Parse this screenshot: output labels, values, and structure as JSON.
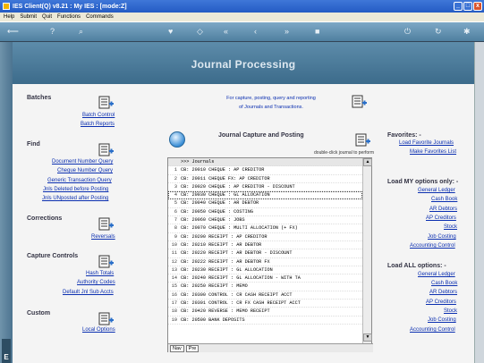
{
  "window": {
    "title": "IES Client(Q) v8.21 : My IES :         [mode:Z]",
    "buttons": {
      "minimize": "_",
      "restore": "□",
      "close": "x"
    }
  },
  "menu": [
    "Help",
    "Submit",
    "Quit",
    "Functions",
    "Commands"
  ],
  "toolbar_icons": [
    "back-icon",
    "help-icon",
    "search-icon",
    "heart-icon",
    "diamond-icon",
    "rewind-icon",
    "back-arrows-icon",
    "forward-arrows-icon",
    "stop-icon",
    "power-icon",
    "refresh-icon",
    "settings-icon"
  ],
  "header": {
    "title": "Journal Processing"
  },
  "batches": {
    "title": "Batches",
    "links": [
      "Batch Control",
      "Batch Reports"
    ]
  },
  "find": {
    "title": "Find",
    "links": [
      "Document Number Query",
      "Cheque Number Query",
      "Generic Transaction Query",
      "Jnls Deleted before Posting",
      "Jnls UNposted after Posting"
    ]
  },
  "corrections": {
    "title": "Corrections",
    "links": [
      "Reversals"
    ]
  },
  "capture_controls": {
    "title": "Capture Controls",
    "links": [
      "Hash Totals",
      "Authority Codes",
      "Default Jnl Sub Accts"
    ]
  },
  "custom": {
    "title": "Custom",
    "links": [
      "Local Options"
    ]
  },
  "center": {
    "info_line1": "For capture, posting, query and reporting",
    "info_line2": "of Journals and Transactions.",
    "capture_title": "Journal Capture and Posting",
    "hint": "double-click journal to perform"
  },
  "journals": {
    "header": ">>> Journals",
    "rows": [
      {
        "n": "1",
        "t": "CB: 20010 CHEQUE   : AP CREDITOR"
      },
      {
        "n": "2",
        "t": "CB: 20011 CHEQUE FX: AP CREDITOR"
      },
      {
        "n": "3",
        "t": "CB: 20020 CHEQUE   : AP CREDITOR - DISCOUNT"
      },
      {
        "n": "4",
        "t": "CB: 20030 CHEQUE   : GL ALLOCATION"
      },
      {
        "n": "5",
        "t": "CB: 20040 CHEQUE   : AR DEBTOR"
      },
      {
        "n": "6",
        "t": "CB: 20050 CHEQUE   : COSTING"
      },
      {
        "n": "7",
        "t": "CB: 20060 CHEQUE   : JOBS"
      },
      {
        "n": "8",
        "t": "CB: 20070 CHEQUE   : MULTI ALLOCATION (+ FX)"
      },
      {
        "n": "9",
        "t": "CB: 20200 RECEIPT  : AP CREDITOR"
      },
      {
        "n": "10",
        "t": "CB: 20210 RECEIPT  : AR DEBTOR"
      },
      {
        "n": "11",
        "t": "CB: 20220 RECEIPT  : AR DEBTOR - DISCOUNT"
      },
      {
        "n": "12",
        "t": "CB: 20222 RECEIPT : AR DEBTOR FX"
      },
      {
        "n": "13",
        "t": "CB: 20230 RECEIPT  : GL ALLOCATION"
      },
      {
        "n": "14",
        "t": "CB: 20240 RECEIPT  : GL ALLOCATION - WITH TA"
      },
      {
        "n": "15",
        "t": "CB: 20250 RECEIPT  : MEMO"
      },
      {
        "n": "16",
        "t": "CB: 20300 CONTROL  : CR CASH RECEIPT ACCT"
      },
      {
        "n": "17",
        "t": "CB: 20301 CONTROL  : CR FX CASH RECEIPT ACCT"
      },
      {
        "n": "18",
        "t": "CB: 20420 REVERSE  : MEMO RECEIPT"
      },
      {
        "n": "19",
        "t": "CB: 20500 BANK DEPOSITS"
      }
    ],
    "selected_index": 3,
    "tabs": [
      "Nav",
      "Pre"
    ]
  },
  "favorites": {
    "title": "Favorites: -",
    "links": [
      "Load Favorite Journals",
      "Make Favorites List"
    ]
  },
  "my_options": {
    "title": "Load MY options only: -",
    "links": [
      "General Ledger",
      "Cash Book",
      "AR Debtors",
      "AP Creditors",
      "Stock",
      "Job Costing",
      "Accounting Control"
    ]
  },
  "all_options": {
    "title": "Load ALL options: -",
    "links": [
      "General Ledger",
      "Cash Book",
      "AR Debtors",
      "AP Creditors",
      "Stock",
      "Job Costing",
      "Accounting Control"
    ]
  }
}
